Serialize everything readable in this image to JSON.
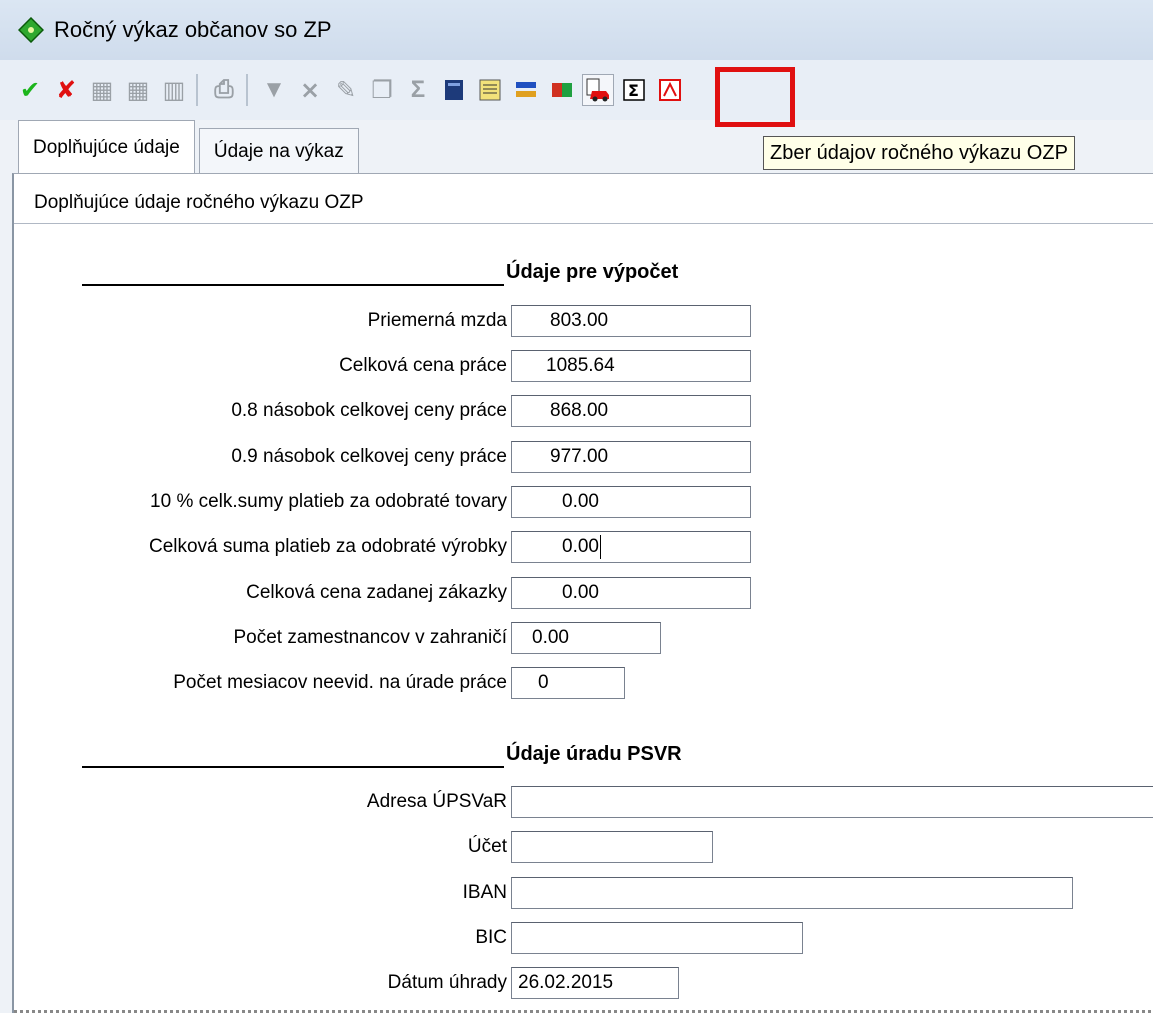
{
  "window": {
    "title": "Ročný výkaz občanov so ZP"
  },
  "toolbar": {
    "items": [
      {
        "icon": "check-icon",
        "glyph": "✔",
        "color": "#1cb51c"
      },
      {
        "icon": "cancel-icon",
        "glyph": "✘",
        "color": "#e01010"
      },
      {
        "icon": "grid-icon",
        "glyph": "▦",
        "color": "#9aa0a6"
      },
      {
        "icon": "grid-edit-icon",
        "glyph": "▦",
        "color": "#9aa0a6"
      },
      {
        "icon": "grid-delete-icon",
        "glyph": "▥",
        "color": "#9aa0a6"
      },
      {
        "icon": "print-icon",
        "glyph": "⎙",
        "color": "#9aa0a6"
      },
      {
        "icon": "filter-icon",
        "glyph": "▼",
        "color": "#9aa0a6"
      },
      {
        "icon": "filter-clear-icon",
        "glyph": "⨯",
        "color": "#9aa0a6"
      },
      {
        "icon": "filter-edit-icon",
        "glyph": "✎",
        "color": "#9aa0a6"
      },
      {
        "icon": "copy-icon",
        "glyph": "❐",
        "color": "#9aa0a6"
      },
      {
        "icon": "sum-icon",
        "glyph": "Σ",
        "color": "#9aa0a6"
      },
      {
        "icon": "book-icon",
        "glyph": "▮",
        "color": "#1d3a7a"
      },
      {
        "icon": "report-icon",
        "glyph": "▤",
        "color": "#c8a000"
      },
      {
        "icon": "transfer-icon",
        "glyph": "⇆",
        "color": "#2050c0"
      },
      {
        "icon": "import-icon",
        "glyph": "◧",
        "color": "#d03020"
      },
      {
        "icon": "car-collect-icon",
        "glyph": "🚗",
        "color": "#d02020"
      },
      {
        "icon": "sigma-box-icon",
        "glyph": "Σ",
        "color": "#000000"
      },
      {
        "icon": "pdf-icon",
        "glyph": "A",
        "color": "#e01010"
      }
    ],
    "tooltip": "Zber údajov ročného výkazu OZP"
  },
  "tabs": [
    {
      "label": "Doplňujúce údaje",
      "active": true
    },
    {
      "label": "Údaje na výkaz",
      "active": false
    }
  ],
  "panel": {
    "header": "Doplňujúce údaje ročného výkazu OZP",
    "section1": {
      "title": "Údaje pre výpočet",
      "fields": [
        {
          "label": "Priemerná mzda",
          "value": "803.00"
        },
        {
          "label": "Celková cena práce",
          "value": "1085.64"
        },
        {
          "label": "0.8 násobok celkovej ceny práce",
          "value": "868.00"
        },
        {
          "label": "0.9 násobok celkovej ceny práce",
          "value": "977.00"
        },
        {
          "label": "10 % celk.sumy platieb za odobraté tovary",
          "value": "0.00"
        },
        {
          "label": "Celková suma platieb za odobraté výrobky",
          "value": "0.00"
        },
        {
          "label": "Celková cena zadanej zákazky",
          "value": "0.00"
        },
        {
          "label": "Počet zamestnancov v zahraničí",
          "value": "0.00"
        },
        {
          "label": "Počet mesiacov neevid. na úrade práce",
          "value": "0"
        }
      ]
    },
    "section2": {
      "title": "Údaje úradu PSVR",
      "fields": [
        {
          "label": "Adresa ÚPSVaR",
          "value": ""
        },
        {
          "label": "Účet",
          "value": ""
        },
        {
          "label": "IBAN",
          "value": ""
        },
        {
          "label": "BIC",
          "value": ""
        },
        {
          "label": "Dátum úhrady",
          "value": "26.02.2015"
        }
      ]
    }
  }
}
